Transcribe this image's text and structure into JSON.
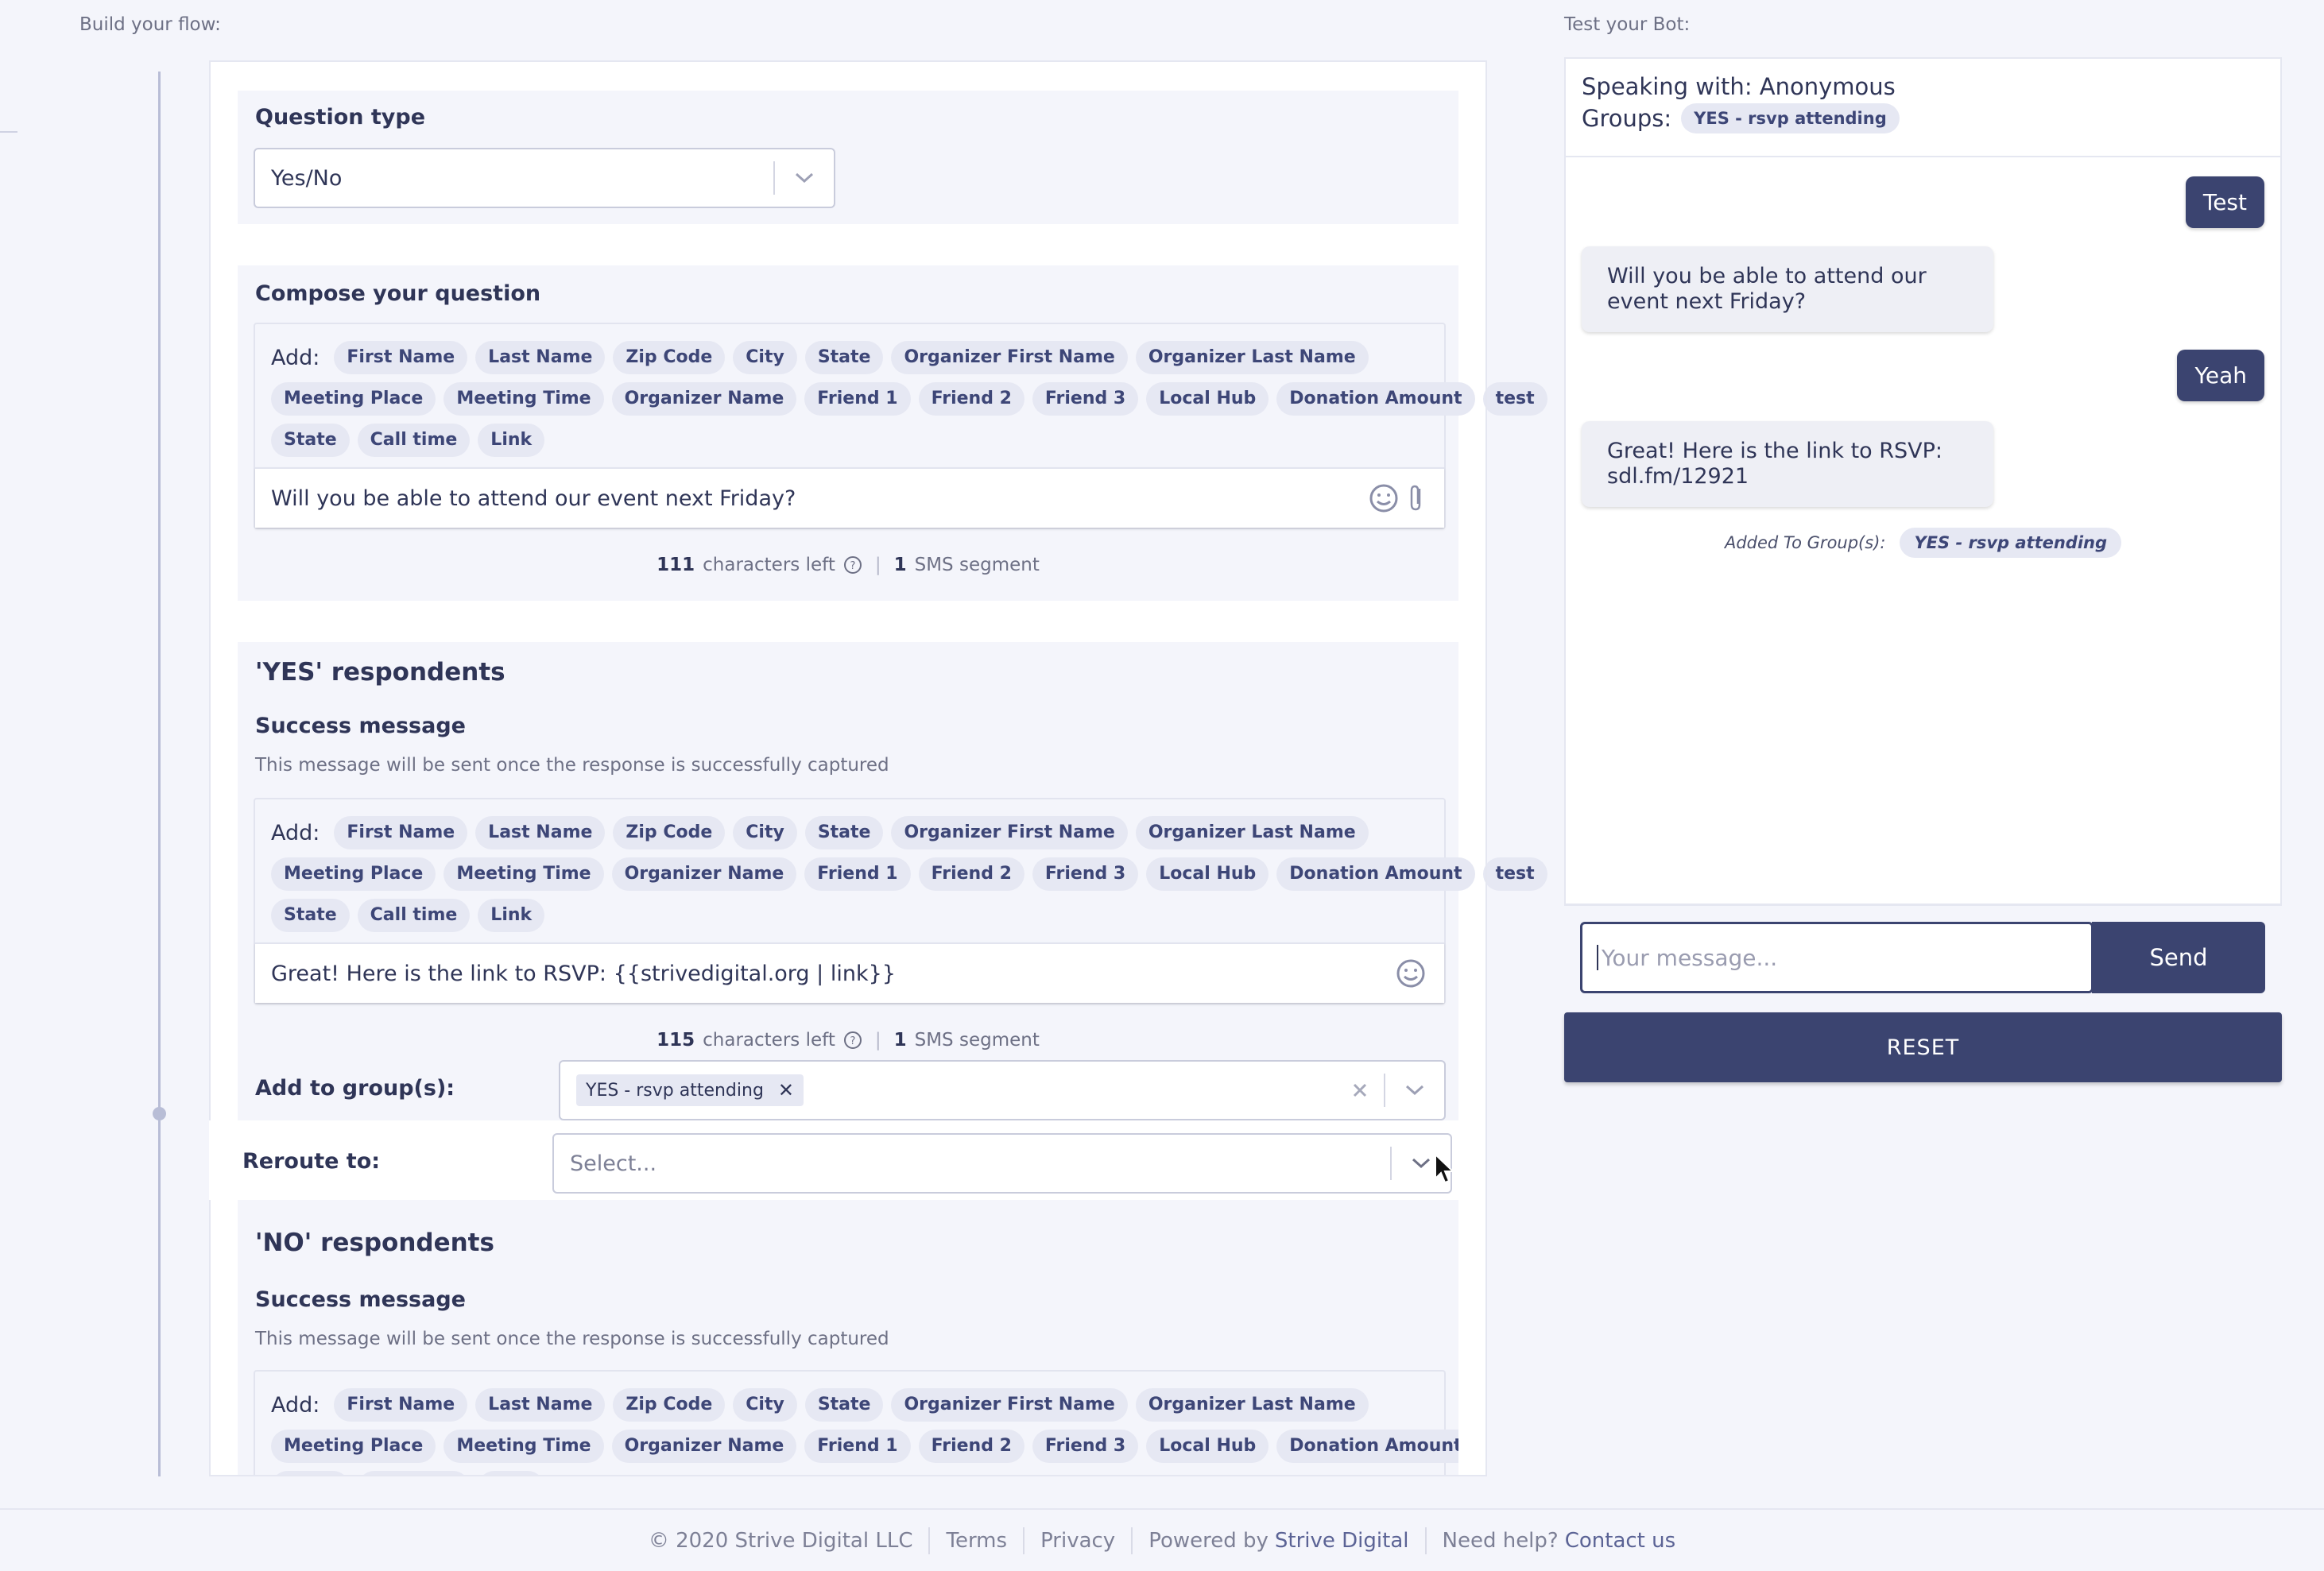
{
  "labels": {
    "build_flow": "Build your flow:",
    "test_bot": "Test your Bot:"
  },
  "question_type": {
    "title": "Question type",
    "value": "Yes/No"
  },
  "compose": {
    "title": "Compose your question",
    "add_label": "Add:",
    "message": "Will you be able to attend our event next Friday?",
    "chars_left": "111",
    "chars_left_label": "characters left",
    "segments": "1",
    "segments_label": "SMS segment"
  },
  "merge_tags": {
    "row1": [
      "First Name",
      "Last Name",
      "Zip Code",
      "City",
      "State",
      "Organizer First Name",
      "Organizer Last Name"
    ],
    "row2": [
      "Meeting Place",
      "Meeting Time",
      "Organizer Name",
      "Friend 1",
      "Friend 2",
      "Friend 3",
      "Local Hub",
      "Donation Amount",
      "test"
    ],
    "row3": [
      "State",
      "Call time",
      "Link"
    ]
  },
  "yes_section": {
    "heading": "'YES' respondents",
    "success_title": "Success message",
    "success_desc": "This message will be sent once the response is successfully captured",
    "add_label": "Add:",
    "message": "Great! Here is the link to RSVP: {{strivedigital.org | link}}",
    "chars_left": "115",
    "chars_left_label": "characters left",
    "segments": "1",
    "segments_label": "SMS segment",
    "add_to_groups_label": "Add to group(s):",
    "group_chip": "YES - rsvp attending",
    "reroute_label": "Reroute to:",
    "reroute_placeholder": "Select..."
  },
  "no_section": {
    "heading": "'NO' respondents",
    "success_title": "Success message",
    "success_desc": "This message will be sent once the response is successfully captured",
    "add_label": "Add:"
  },
  "bot": {
    "speaking_with": "Speaking with: Anonymous",
    "groups_label": "Groups:",
    "group_pill": "YES - rsvp attending",
    "messages": [
      {
        "from": "user",
        "text": "Test"
      },
      {
        "from": "bot",
        "text": "Will you be able to attend our event next Friday?"
      },
      {
        "from": "user",
        "text": "Yeah"
      },
      {
        "from": "bot",
        "text": "Great! Here is the link to RSVP: sdl.fm/12921"
      }
    ],
    "added_to_groups_label": "Added To Group(s):",
    "added_group": "YES - rsvp attending",
    "input_placeholder": "Your message...",
    "send_label": "Send",
    "reset_label": "RESET"
  },
  "footer": {
    "copyright": "© 2020 Strive Digital LLC",
    "terms": "Terms",
    "privacy": "Privacy",
    "powered_prefix": "Powered by",
    "powered_link": "Strive Digital",
    "help_prefix": "Need help?",
    "help_link": "Contact us"
  },
  "colors": {
    "accent": "#3b4470",
    "background": "#f4f5fb",
    "tag_bg": "#e6e8f3"
  }
}
